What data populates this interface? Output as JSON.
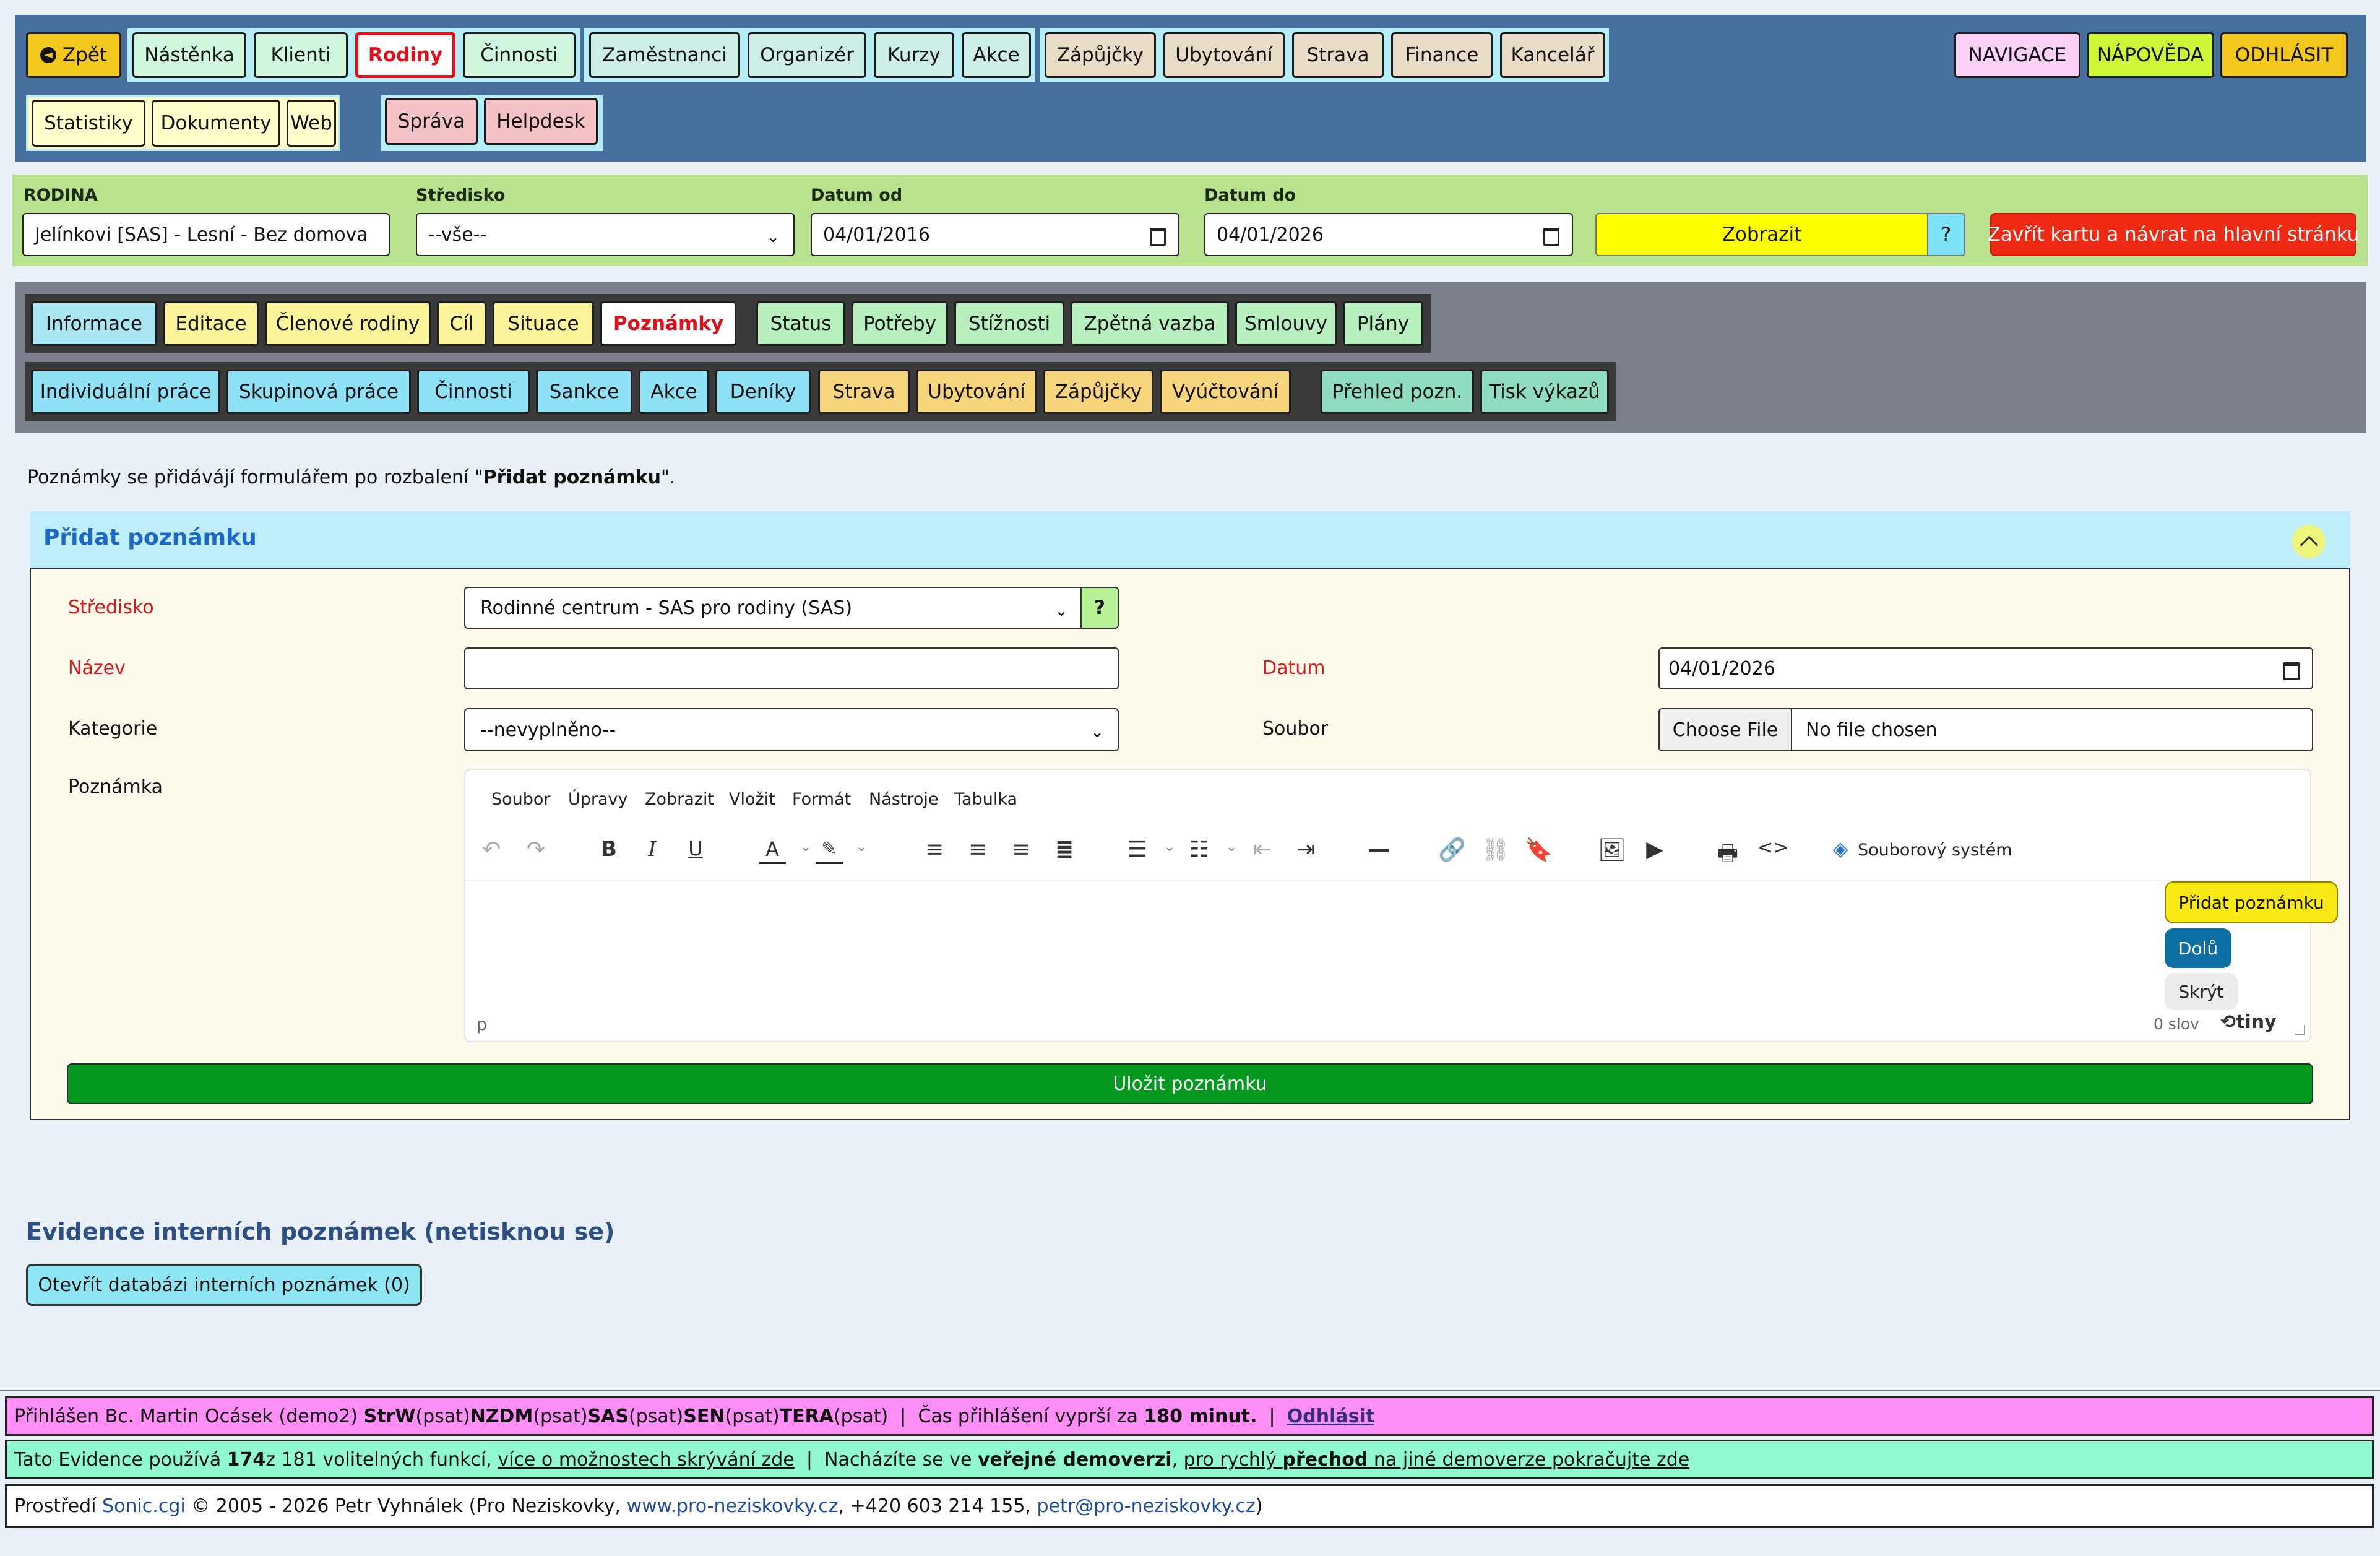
{
  "nav": {
    "back": "Zpět",
    "group1": [
      "Nástěnka",
      "Klienti",
      "Rodiny",
      "Činnosti"
    ],
    "group2": [
      "Zaměstnanci",
      "Organizér",
      "Kurzy",
      "Akce"
    ],
    "group3": [
      "Zápůjčky",
      "Ubytování",
      "Strava",
      "Finance",
      "Kancelář"
    ],
    "right": [
      "NAVIGACE",
      "NÁPOVĚDA",
      "ODHLÁSIT"
    ],
    "row2_group1": [
      "Statistiky",
      "Dokumenty",
      "Web"
    ],
    "row2_group2": [
      "Správa",
      "Helpdesk"
    ]
  },
  "filter": {
    "family_label": "RODINA",
    "family_value": "Jelínkovi [SAS] - Lesní - Bez domova",
    "center_label": "Středisko",
    "center_value": "--vše--",
    "date_from_label": "Datum od",
    "date_from_value": "04/01/2016",
    "date_to_label": "Datum do",
    "date_to_value": "04/01/2026",
    "show_button": "Zobrazit",
    "help": "?",
    "close_button": "Zavřít kartu a návrat na hlavní stránku"
  },
  "tabs": {
    "row1_g1": [
      "Informace",
      "Editace",
      "Členové rodiny",
      "Cíl",
      "Situace",
      "Poznámky"
    ],
    "row1_g2": [
      "Status",
      "Potřeby",
      "Stížnosti",
      "Zpětná vazba",
      "Smlouvy",
      "Plány"
    ],
    "row2_g1": [
      "Individuální práce",
      "Skupinová práce",
      "Činnosti",
      "Sankce",
      "Akce",
      "Deníky"
    ],
    "row2_g2": [
      "Strava",
      "Ubytování",
      "Zápůjčky",
      "Vyúčtování"
    ],
    "row2_g3": [
      "Přehled pozn.",
      "Tisk výkazů"
    ]
  },
  "intro": {
    "before": "Poznámky se přidávájí formulářem po rozbalení \"",
    "bold": "Přidat poznámku",
    "after": "\"."
  },
  "panel": {
    "title": "Přidat poznámku",
    "center_label": "Středisko",
    "center_value": "Rodinné centrum - SAS pro rodiny (SAS)",
    "center_help": "?",
    "name_label": "Název",
    "name_value": "",
    "date_label": "Datum",
    "date_value": "04/01/2026",
    "category_label": "Kategorie",
    "category_value": "--nevyplněno--",
    "file_label": "Soubor",
    "file_button": "Choose File",
    "file_status": "No file chosen",
    "note_label": "Poznámka",
    "save_button": "Uložit poznámku"
  },
  "editor": {
    "menu": [
      "Soubor",
      "Úpravy",
      "Zobrazit",
      "Vložit",
      "Formát",
      "Nástroje",
      "Tabulka"
    ],
    "filesystem": "Souborový systém",
    "status_path": "p",
    "word_count": "0 slov",
    "brand": "tiny"
  },
  "floating": {
    "add": "Přidat poznámku",
    "down": "Dolů",
    "hide": "Skrýt"
  },
  "internal": {
    "heading": "Evidence interních poznámek (netisknou se)",
    "button": "Otevřít databázi interních poznámek  (0)"
  },
  "footer": {
    "line1_prefix": "Přihlášen Bc. Martin Ocásek (demo2) ",
    "roles": [
      {
        "name": "StrW",
        "type": " (psat) "
      },
      {
        "name": "NZDM",
        "type": " (psat) "
      },
      {
        "name": "SAS",
        "type": " (psat) "
      },
      {
        "name": "SEN",
        "type": " (psat) "
      },
      {
        "name": "TERA",
        "type": " (psat)"
      }
    ],
    "session_text": "  |  Čas přihlášení vyprší za ",
    "session_minutes": "180 minut.",
    "sep": "  |  ",
    "logout": "Odhlásit",
    "line2_a": "Tato Evidence používá ",
    "line2_count": "174",
    "line2_b": " z 181 volitelných funkcí, ",
    "line2_link": "více o možnostech skrývání zde",
    "line2_c": "  |  Nacházíte se ve ",
    "line2_bold": "veřejné demoverzi",
    "line2_d": ", ",
    "line2_link2a": "pro rychlý ",
    "line2_link2b": "přechod",
    "line2_link2c": " na jiné demoverze pokračujte zde",
    "line3_a": "Prostředí ",
    "line3_sonic": "Sonic.cgi",
    "line3_b": " © 2005 - 2026 Petr Vyhnálek (Pro Neziskovky, ",
    "line3_web": "www.pro-neziskovky.cz",
    "line3_c": ", +420 603 214 155, ",
    "line3_mail": "petr@pro-neziskovky.cz",
    "line3_d": ")"
  },
  "colors": {
    "topnav": "#476f9e",
    "filter": "#b8e28e",
    "tabs": "#7b808c",
    "panel_head": "#bfeefa",
    "save": "#05981e",
    "footer1": "#fd8ef6",
    "footer2": "#91f9d0"
  }
}
